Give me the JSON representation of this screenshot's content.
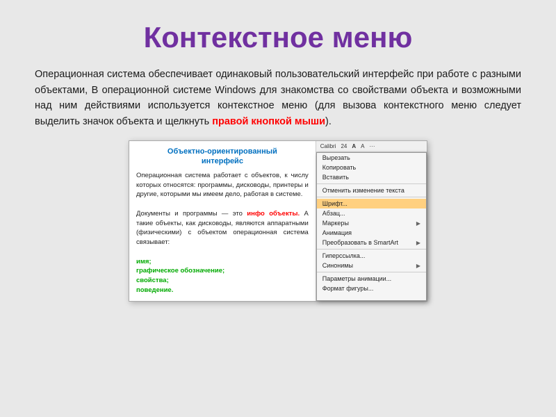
{
  "slide": {
    "title": "Контекстное меню",
    "body_text": "Операционная    система    обеспечивает    одинаковый пользовательский интерфейс при работе с разными объектами, В операционной системе Windows для знакомства со свойствами объекта и возможными над ним действиями используется контекстное меню  (для вызова контекстного меню следует выделить значок объекта и щелкнуть ",
    "highlight": "правой кнопкой мыши",
    "body_suffix": ").",
    "doc_title_line1": "Объектно-ориентированный",
    "doc_title_line2": "интерфейс",
    "doc_text1": "Операционная система работает с объектов, к числу которых относятся: программы, дисководы, принтеры и другие, которыми мы имеем дело, работая в системе.",
    "doc_text2": "Документы и программы — это ",
    "doc_text2_highlight": "инфо объекты.",
    "doc_text2_rest": " А такие объекты, как дисководы, являются аппаратными (физическими) с объектом операционная система связывает:",
    "doc_list": [
      "имя;",
      "графическое обозначение;",
      "свойства;",
      "поведение."
    ],
    "toolbar_text": "Calibri  24  A  A",
    "menu_items": [
      {
        "label": "Вырезать",
        "has_arrow": false
      },
      {
        "label": "Копировать",
        "has_arrow": false
      },
      {
        "label": "Вставить",
        "has_arrow": false
      },
      {
        "label": "Отменить изменение текста",
        "has_arrow": false
      },
      {
        "label": "Шрифт...",
        "has_arrow": false,
        "highlighted": true
      },
      {
        "label": "Абзац...",
        "has_arrow": false
      },
      {
        "label": "Маркеры",
        "has_arrow": true
      },
      {
        "label": "Анимация",
        "has_arrow": false
      },
      {
        "label": "Преобразовать в SmartArt",
        "has_arrow": true
      },
      {
        "label": "Гиперссылка...",
        "has_arrow": false
      },
      {
        "label": "Синонимы",
        "has_arrow": true
      },
      {
        "label": "Параметры анимации...",
        "has_arrow": false
      },
      {
        "label": "Формат фигуры...",
        "has_arrow": false
      }
    ]
  }
}
